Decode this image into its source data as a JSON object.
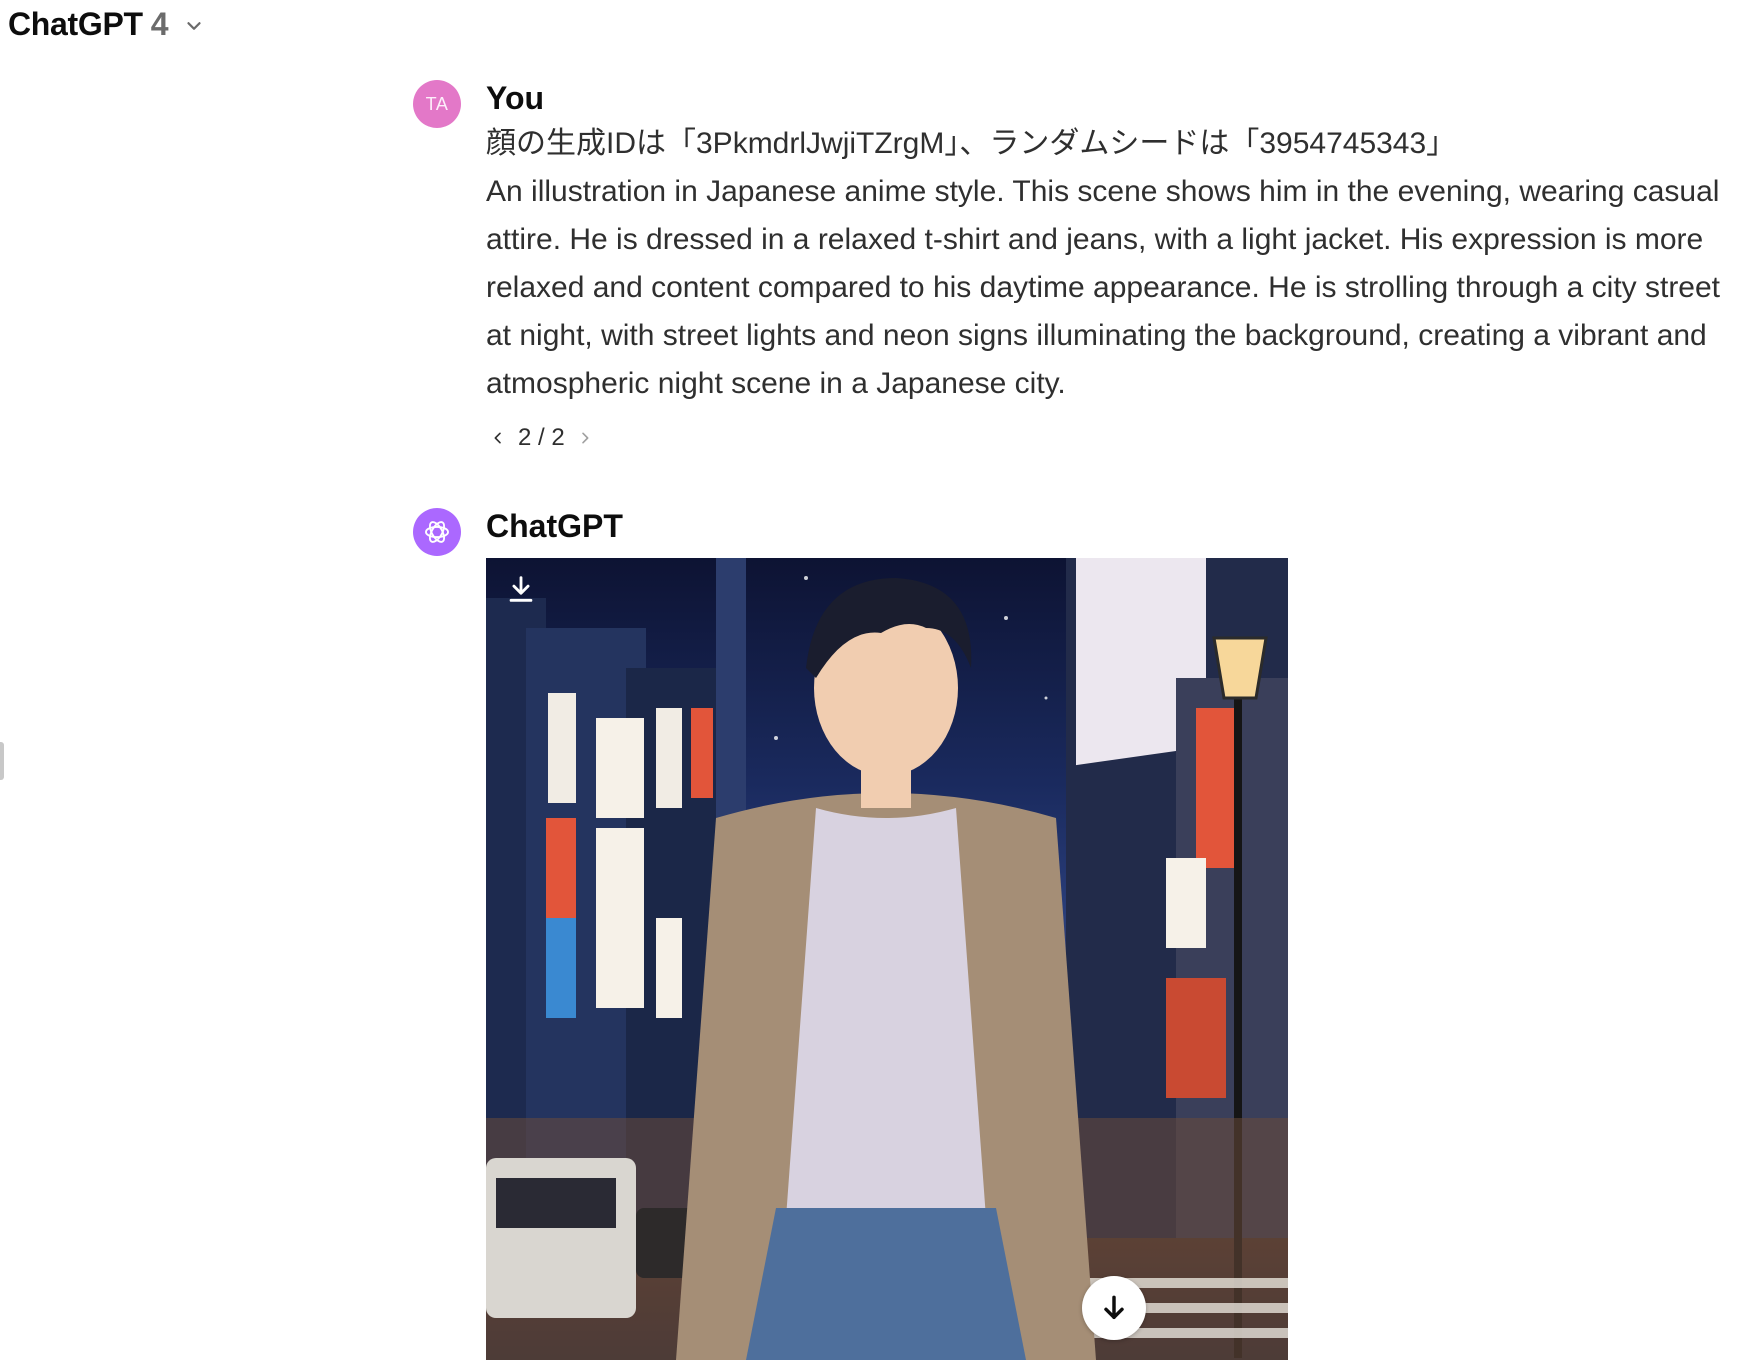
{
  "header": {
    "model_name": "ChatGPT",
    "model_version": "4"
  },
  "user_message": {
    "avatar_initials": "TA",
    "author": "You",
    "text": "顔の生成IDは「3PkmdrlJwjiTZrgM」、ランダムシードは「3954745343」\nAn illustration in Japanese anime style. This scene shows him in the evening, wearing casual attire. He is dressed in a relaxed t-shirt and jeans, with a light jacket. His expression is more relaxed and content compared to his daytime appearance. He is strolling through a city street at night, with street lights and neon signs illuminating the background, creating a vibrant and atmospheric night scene in a Japanese city.",
    "pager": "2 / 2"
  },
  "assistant_message": {
    "author": "ChatGPT",
    "image_icons": {
      "top_left": "download-icon",
      "bottom_right": "arrow-down-icon"
    }
  },
  "colors": {
    "user_avatar": "#e378c8",
    "assistant_avatar": "#ab68ff",
    "text_primary": "#0d0d0d",
    "text_secondary": "#2f2f2f",
    "muted": "#6b6b6b"
  }
}
